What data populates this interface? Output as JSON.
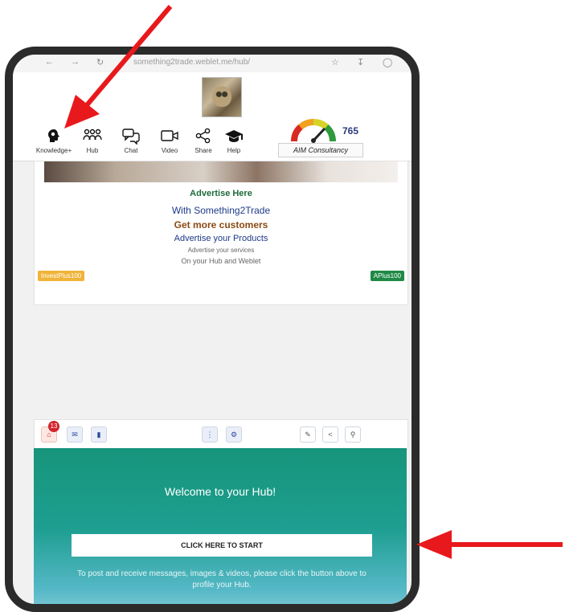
{
  "browser": {
    "url": "something2trade.weblet.me/hub/"
  },
  "nav": {
    "items": [
      {
        "label": "Knowledge+"
      },
      {
        "label": "Hub"
      },
      {
        "label": "Chat"
      },
      {
        "label": "Video"
      },
      {
        "label": "Share"
      },
      {
        "label": "Help"
      }
    ]
  },
  "score": {
    "value": "765",
    "consultancy": "AIM Consultancy"
  },
  "advert": {
    "title": "Advertise Here",
    "line1": "With Something2Trade",
    "line2": "Get more customers",
    "line3": "Advertise your Products",
    "line4": "Advertise your services",
    "line5": "On your Hub and Weblet",
    "pill_left": "InvestPlus100",
    "pill_right": "APlus100"
  },
  "toolbar": {
    "notification_count": "13"
  },
  "hub": {
    "welcome": "Welcome to your Hub!",
    "start_button": "CLICK HERE TO START",
    "note": "To post and receive messages, images & videos, please click the button above to profile your Hub."
  },
  "colors": {
    "arrow": "#e8191c",
    "teal": "#17957b",
    "advert_green": "#1d6b3a",
    "advert_orange": "#8a4a12",
    "pill_yellow": "#f0b43a",
    "pill_green": "#1f8a45"
  }
}
